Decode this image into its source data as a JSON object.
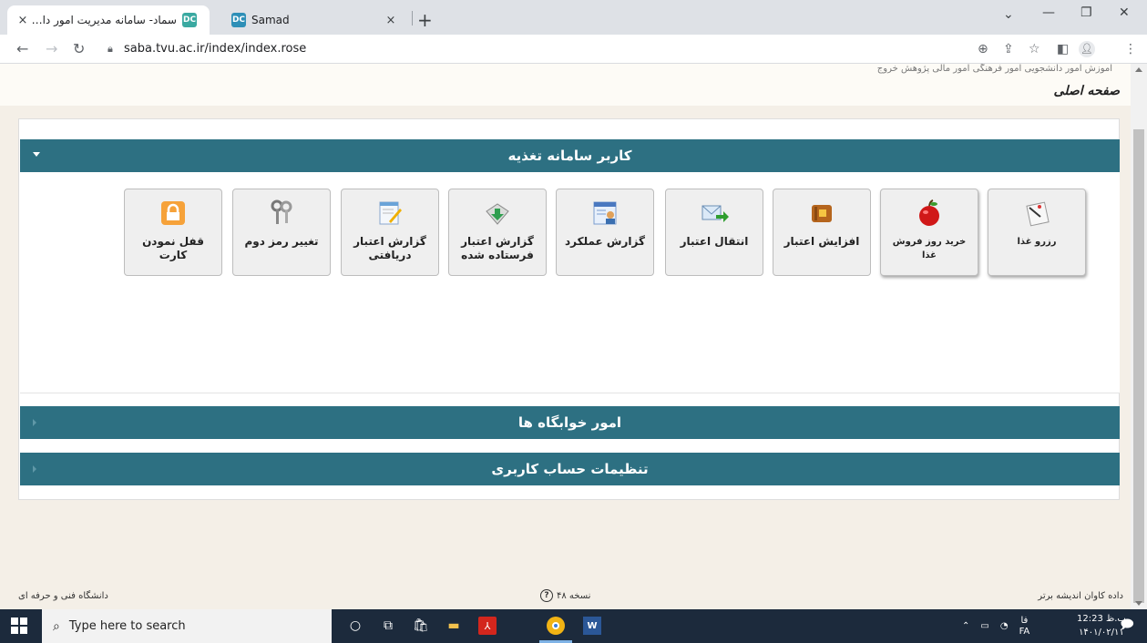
{
  "browser": {
    "tabs": [
      {
        "title": "سماد- سامانه مدیریت امور دانشجو",
        "favicon": "DC",
        "close": "×"
      },
      {
        "title": "Samad",
        "favicon": "DC",
        "close": "×"
      }
    ],
    "new_tab": "+",
    "url": "saba.tvu.ac.ir/index/index.rose"
  },
  "page": {
    "breadcrumb": "صفحه اصلی",
    "top_cutoff_text": "اموزش امور دانشجویی امور فرهنگی امور مالی پژوهش خروج",
    "sections": [
      {
        "title": "کاربر سامانه تغذیه",
        "expanded": true
      },
      {
        "title": "امور خوابگاه ها",
        "expanded": false
      },
      {
        "title": "تنظیمات حساب کاربری",
        "expanded": false
      }
    ],
    "tiles": [
      {
        "label": "رزرو غذا",
        "icon": "food-reserve-icon"
      },
      {
        "label": "خرید روز فروش غذا",
        "icon": "apple-icon"
      },
      {
        "label": "افزایش اعتبار",
        "icon": "wallet-icon"
      },
      {
        "label": "انتقال اعتبار",
        "icon": "envelope-arrow-icon"
      },
      {
        "label": "گزارش عملکرد",
        "icon": "report-user-icon"
      },
      {
        "label": "گزارش اعتبار فرستاده شده",
        "icon": "sent-download-icon"
      },
      {
        "label": "گزارش اعتبار دریافتی",
        "icon": "notepad-pencil-icon"
      },
      {
        "label": "تغییر رمز دوم",
        "icon": "keys-icon"
      },
      {
        "label": "قفل نمودن کارت",
        "icon": "lock-icon"
      }
    ]
  },
  "footer": {
    "right": "داده کاوان اندیشه برتر",
    "version": "نسخه ۴۸",
    "left": "دانشگاه فنی و حرفه ای"
  },
  "taskbar": {
    "search_placeholder": "Type here to search",
    "lang": "FA",
    "lang_top": "فا",
    "time": "12:23 ب.ظ",
    "date": "۱۴۰۱/۰۲/۱۱"
  },
  "colors": {
    "section_header": "#2d7082",
    "page_bg": "#f4efe7",
    "tile_bg": "#efefef"
  }
}
